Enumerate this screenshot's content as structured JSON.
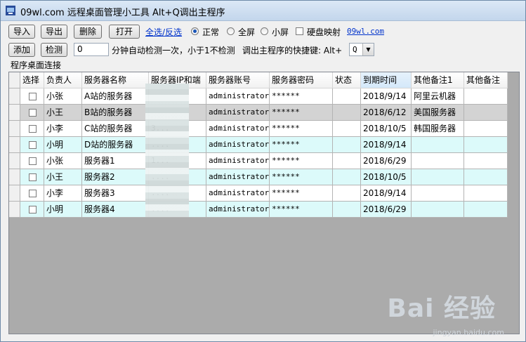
{
  "window": {
    "title": "09wl.com 远程桌面管理小工具 Alt+Q调出主程序"
  },
  "toolbar": {
    "import_label": "导入",
    "export_label": "导出",
    "delete_label": "删除",
    "open_label": "打开",
    "select_toggle_label": "全选/反选",
    "mode_normal": "正常",
    "mode_fullscreen": "全屏",
    "mode_small": "小屏",
    "disk_map_label": "硬盘映射",
    "site_link": "09wl.com",
    "add_label": "添加",
    "check_label": "检测",
    "interval_value": "0",
    "interval_text": "分钟自动检测一次，小于1不检测",
    "hotkey_text": "调出主程序的快捷键: Alt+",
    "hotkey_value": "Q"
  },
  "group": {
    "label": "程序桌面连接"
  },
  "table": {
    "columns": [
      "选择",
      "负责人",
      "服务器名称",
      "服务器IP和端",
      "服务器账号",
      "服务器密码",
      "状态",
      "到期时间",
      "其他备注1",
      "其他备注"
    ],
    "rows": [
      [
        "",
        "小张",
        "A站的服务器",
        "",
        "administrator",
        "******",
        "",
        "2018/9/14",
        "阿里云机器",
        ""
      ],
      [
        "",
        "小王",
        "B站的服务器",
        "",
        "administrator",
        "******",
        "",
        "2018/6/12",
        "美国服务器",
        ""
      ],
      [
        "",
        "小李",
        "C站的服务器",
        "3...",
        "administrator",
        "******",
        "",
        "2018/10/5",
        "韩国服务器",
        ""
      ],
      [
        "",
        "小明",
        "D站的服务器",
        "....",
        "administrator",
        "******",
        "",
        "2018/9/14",
        "",
        ""
      ],
      [
        "",
        "小张",
        "服务器1",
        "1...",
        "administrator",
        "******",
        "",
        "2018/6/29",
        "",
        ""
      ],
      [
        "",
        "小王",
        "服务器2",
        "....",
        "administrator",
        "******",
        "",
        "2018/10/5",
        "",
        ""
      ],
      [
        "",
        "小李",
        "服务器3",
        "....",
        "administrator",
        "******",
        "",
        "2018/9/14",
        "",
        ""
      ],
      [
        "",
        "小明",
        "服务器4",
        "....",
        "administrator",
        "******",
        "",
        "2018/6/29",
        "",
        ""
      ]
    ]
  },
  "watermark": {
    "main": "Bai 经验",
    "sub": "jingyan.baidu.com"
  },
  "colors": {
    "row_alt": "#dcfafa",
    "row_selected": "#d3d3d3",
    "row_default": "#ffffff",
    "link": "#0033cc"
  }
}
